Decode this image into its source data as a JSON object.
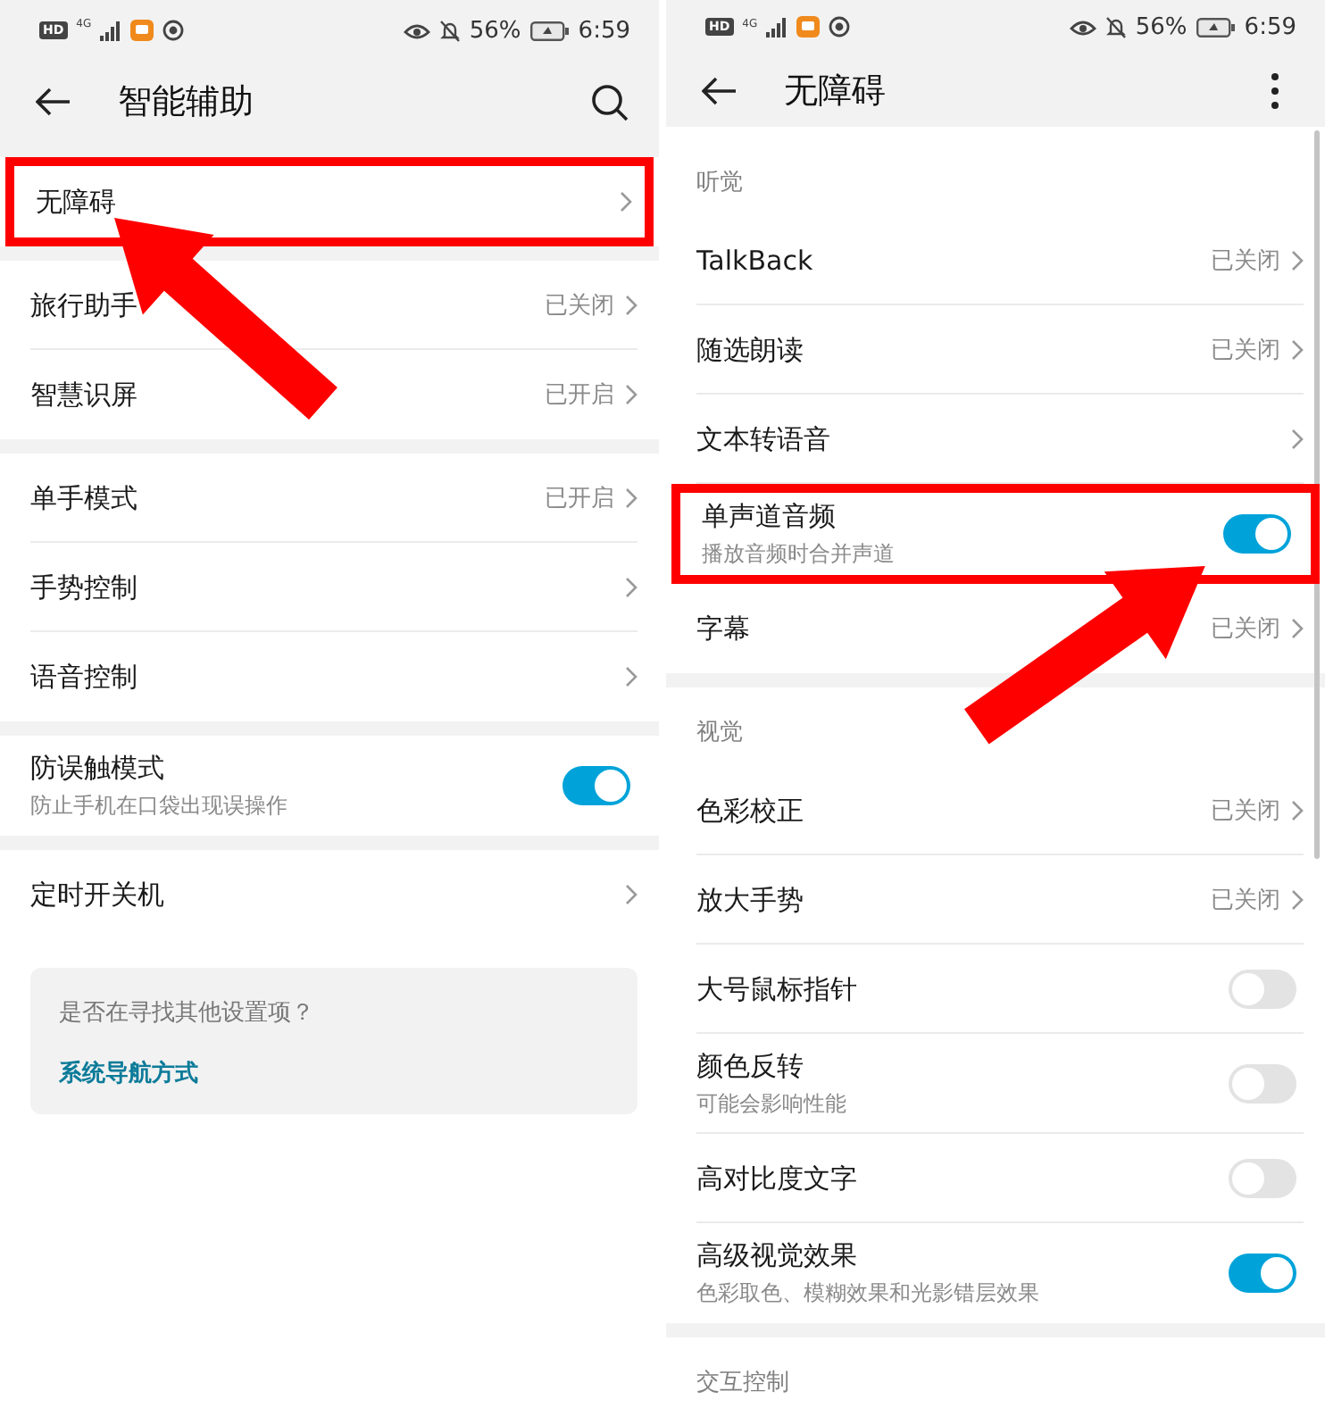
{
  "panels": [
    {
      "status_bar": {
        "hd": "HD",
        "network": "4G",
        "battery": "56%",
        "time": "6:59"
      },
      "header": {
        "title": "智能辅助",
        "action": {
          "kind": "search"
        }
      },
      "arrow": {
        "kind": "left"
      },
      "scrollbar": false,
      "items": [
        {
          "kind": "gap"
        },
        {
          "kind": "nav",
          "label": "无障碍",
          "highlighted": true
        },
        {
          "kind": "gap"
        },
        {
          "kind": "nav",
          "label": "旅行助手",
          "value": "已关闭",
          "highlighted": false
        },
        {
          "kind": "nav",
          "label": "智慧识屏",
          "value": "已开启",
          "highlighted": false
        },
        {
          "kind": "gap"
        },
        {
          "kind": "nav",
          "label": "单手模式",
          "value": "已开启",
          "highlighted": false
        },
        {
          "kind": "nav",
          "label": "手势控制",
          "highlighted": false
        },
        {
          "kind": "nav",
          "label": "语音控制",
          "highlighted": false
        },
        {
          "kind": "gap"
        },
        {
          "kind": "toggle",
          "label": "防误触模式",
          "subtitle": "防止手机在口袋出现误操作",
          "on": true,
          "highlighted": false
        },
        {
          "kind": "gap"
        },
        {
          "kind": "nav",
          "label": "定时开关机",
          "highlighted": false
        },
        {
          "kind": "card",
          "question": "是否在寻找其他设置项？",
          "link": "系统导航方式"
        }
      ]
    },
    {
      "status_bar": {
        "hd": "HD",
        "network": "4G",
        "battery": "56%",
        "time": "6:59"
      },
      "header": {
        "title": "无障碍",
        "action": {
          "kind": "more"
        }
      },
      "arrow": {
        "kind": "right"
      },
      "scrollbar": true,
      "items": [
        {
          "kind": "header",
          "label": "听觉"
        },
        {
          "kind": "nav",
          "label": "TalkBack",
          "value": "已关闭",
          "highlighted": false
        },
        {
          "kind": "nav",
          "label": "随选朗读",
          "value": "已关闭",
          "highlighted": false
        },
        {
          "kind": "nav",
          "label": "文本转语音",
          "highlighted": false
        },
        {
          "kind": "toggle",
          "label": "单声道音频",
          "subtitle": "播放音频时合并声道",
          "on": true,
          "highlighted": true
        },
        {
          "kind": "nav",
          "label": "字幕",
          "value": "已关闭",
          "highlighted": false
        },
        {
          "kind": "gap"
        },
        {
          "kind": "header",
          "label": "视觉"
        },
        {
          "kind": "nav",
          "label": "色彩校正",
          "value": "已关闭",
          "highlighted": false
        },
        {
          "kind": "nav",
          "label": "放大手势",
          "value": "已关闭",
          "highlighted": false
        },
        {
          "kind": "toggle",
          "label": "大号鼠标指针",
          "on": false,
          "highlighted": false
        },
        {
          "kind": "toggle",
          "label": "颜色反转",
          "subtitle": "可能会影响性能",
          "on": false,
          "highlighted": false
        },
        {
          "kind": "toggle",
          "label": "高对比度文字",
          "on": false,
          "highlighted": false
        },
        {
          "kind": "toggle",
          "label": "高级视觉效果",
          "subtitle": "色彩取色、模糊效果和光影错层效果",
          "on": true,
          "highlighted": false
        },
        {
          "kind": "gap"
        },
        {
          "kind": "header",
          "label": "交互控制"
        }
      ]
    }
  ]
}
